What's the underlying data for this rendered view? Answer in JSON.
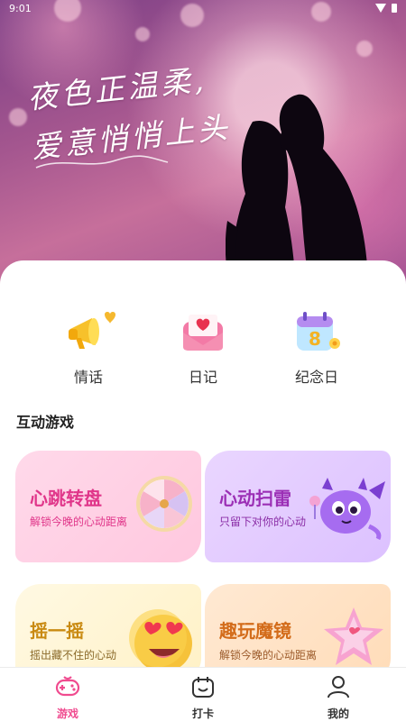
{
  "status_bar": {
    "time": "9:01"
  },
  "hero": {
    "line1": "夜色正温柔,",
    "line2": "爱意悄悄上头"
  },
  "quick_actions": [
    {
      "label": "情话",
      "icon": "megaphone-heart-icon"
    },
    {
      "label": "日记",
      "icon": "love-letter-icon"
    },
    {
      "label": "纪念日",
      "icon": "calendar-8-icon"
    }
  ],
  "section_title": "互动游戏",
  "games": [
    {
      "title": "心跳转盘",
      "subtitle": "解锁今晚的心动距离",
      "icon": "spin-wheel-icon",
      "color": "#e0368a"
    },
    {
      "title": "心动扫雷",
      "subtitle": "只留下对你的心动",
      "icon": "purple-monster-icon",
      "color": "#9b2fb5"
    },
    {
      "title": "摇一摇",
      "subtitle": "摇出藏不住的心动",
      "icon": "heart-eyes-emoji-icon",
      "color": "#c98a11"
    },
    {
      "title": "趣玩魔镜",
      "subtitle": "解锁今晚的心动距离",
      "icon": "star-mirror-icon",
      "color": "#d36c1a"
    }
  ],
  "tabs": [
    {
      "label": "游戏",
      "icon": "gamepad-icon",
      "active": true
    },
    {
      "label": "打卡",
      "icon": "checkin-icon",
      "active": false
    },
    {
      "label": "我的",
      "icon": "profile-icon",
      "active": false
    }
  ],
  "accent_color": "#f04b8f"
}
